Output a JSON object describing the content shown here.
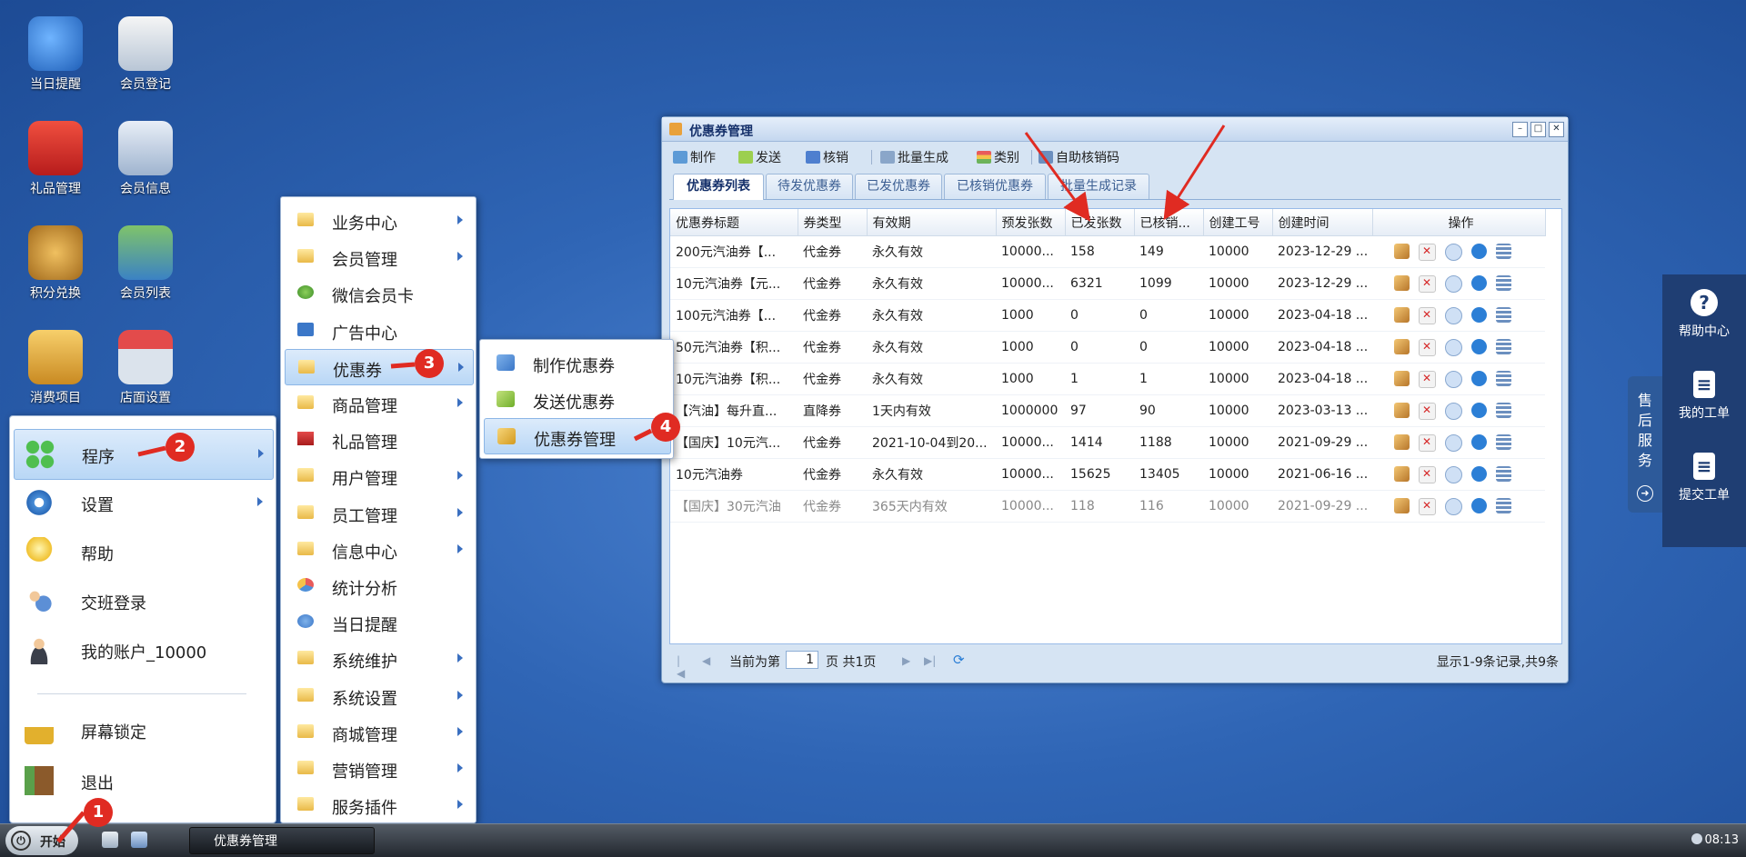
{
  "desktop_icons": [
    {
      "label": "当日提醒",
      "icon": "reminder-icon"
    },
    {
      "label": "会员登记",
      "icon": "member-register-icon"
    },
    {
      "label": "礼品管理",
      "icon": "gift-icon"
    },
    {
      "label": "会员信息",
      "icon": "member-info-icon"
    },
    {
      "label": "积分兑换",
      "icon": "points-exchange-icon"
    },
    {
      "label": "会员列表",
      "icon": "member-list-icon"
    },
    {
      "label": "消费项目",
      "icon": "basket-icon"
    },
    {
      "label": "店面设置",
      "icon": "store-icon"
    }
  ],
  "start_menu": {
    "items": [
      {
        "label": "程序",
        "icon": "program-icon"
      },
      {
        "label": "设置",
        "icon": "gear-icon"
      },
      {
        "label": "帮助",
        "icon": "bulb-icon"
      },
      {
        "label": "交班登录",
        "icon": "users-icon"
      },
      {
        "label": "我的账户_10000",
        "icon": "account-icon"
      },
      {
        "label": "屏幕锁定",
        "icon": "lock-icon"
      },
      {
        "label": "退出",
        "icon": "exit-icon"
      }
    ]
  },
  "program_menu": {
    "items": [
      {
        "label": "业务中心"
      },
      {
        "label": "会员管理"
      },
      {
        "label": "微信会员卡"
      },
      {
        "label": "广告中心"
      },
      {
        "label": "优惠券"
      },
      {
        "label": "商品管理"
      },
      {
        "label": "礼品管理"
      },
      {
        "label": "用户管理"
      },
      {
        "label": "员工管理"
      },
      {
        "label": "信息中心"
      },
      {
        "label": "统计分析"
      },
      {
        "label": "当日提醒"
      },
      {
        "label": "系统维护"
      },
      {
        "label": "系统设置"
      },
      {
        "label": "商城管理"
      },
      {
        "label": "营销管理"
      },
      {
        "label": "服务插件"
      }
    ]
  },
  "coupon_menu": {
    "items": [
      {
        "label": "制作优惠券"
      },
      {
        "label": "发送优惠券"
      },
      {
        "label": "优惠券管理"
      }
    ]
  },
  "badges": [
    "1",
    "2",
    "3",
    "4"
  ],
  "window": {
    "title": "优惠券管理",
    "toolbar": [
      "制作",
      "发送",
      "核销",
      "批量生成",
      "类别",
      "自助核销码"
    ],
    "tabs": [
      "优惠券列表",
      "待发优惠券",
      "已发优惠券",
      "已核销优惠券",
      "批量生成记录"
    ],
    "columns": [
      "优惠券标题",
      "券类型",
      "有效期",
      "预发张数",
      "已发张数",
      "已核销...",
      "创建工号",
      "创建时间",
      "操作"
    ],
    "rows": [
      [
        "200元汽油券【...",
        "代金券",
        "永久有效",
        "10000...",
        "158",
        "149",
        "10000",
        "2023-12-29 ..."
      ],
      [
        "10元汽油券【元...",
        "代金券",
        "永久有效",
        "10000...",
        "6321",
        "1099",
        "10000",
        "2023-12-29 ..."
      ],
      [
        "100元汽油券【...",
        "代金券",
        "永久有效",
        "1000",
        "0",
        "0",
        "10000",
        "2023-04-18 ..."
      ],
      [
        "50元汽油券【积...",
        "代金券",
        "永久有效",
        "1000",
        "0",
        "0",
        "10000",
        "2023-04-18 ..."
      ],
      [
        "10元汽油券【积...",
        "代金券",
        "永久有效",
        "1000",
        "1",
        "1",
        "10000",
        "2023-04-18 ..."
      ],
      [
        "【汽油】每升直...",
        "直降券",
        "1天内有效",
        "1000000",
        "97",
        "90",
        "10000",
        "2023-03-13 ..."
      ],
      [
        "【国庆】10元汽...",
        "代金券",
        "2021-10-04到20...",
        "10000...",
        "1414",
        "1188",
        "10000",
        "2021-09-29 ..."
      ],
      [
        "10元汽油券",
        "代金券",
        "永久有效",
        "10000...",
        "15625",
        "13405",
        "10000",
        "2021-06-16 ..."
      ],
      [
        "【国庆】30元汽油",
        "代金券",
        "365天内有效",
        "10000...",
        "118",
        "116",
        "10000",
        "2021-09-29 ..."
      ]
    ],
    "pager": {
      "prefix": "当前为第",
      "page": "1",
      "suffix": "页 共1页",
      "summary": "显示1-9条记录,共9条"
    }
  },
  "taskbar": {
    "start_label": "开始",
    "task": "优惠券管理",
    "clock": "08:13"
  },
  "service_panel": {
    "tab_label": "售后服务",
    "items": [
      {
        "label": "帮助中心",
        "icon": "question-icon"
      },
      {
        "label": "我的工单",
        "icon": "clipboard-icon"
      },
      {
        "label": "提交工单",
        "icon": "clipboard-icon"
      }
    ]
  }
}
